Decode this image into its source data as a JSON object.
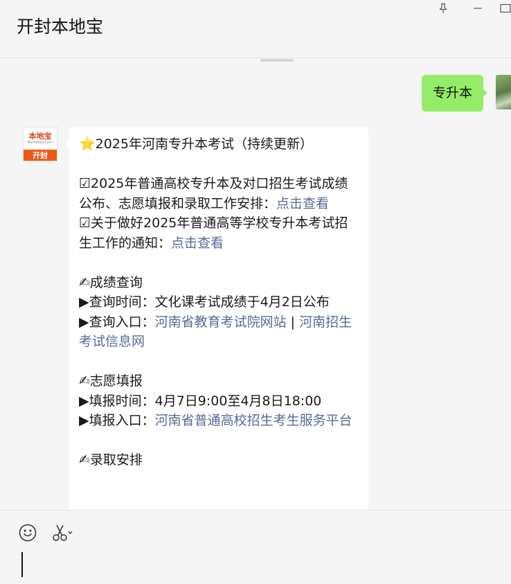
{
  "window": {
    "title": "开封本地宝"
  },
  "messages": {
    "outgoing": {
      "text": "专升本"
    },
    "incoming": {
      "avatar": {
        "logo_text": "本地宝",
        "logo_sub": "Bendibao.com",
        "city": "开封"
      },
      "lines": [
        {
          "segments": [
            {
              "text": "⭐2025年河南专升本考试（持续更新）"
            }
          ]
        },
        {
          "blank": true
        },
        {
          "segments": [
            {
              "text": "☑2025年普通高校专升本及对口招生考试成绩公布、志愿填报和录取工作安排："
            },
            {
              "text": "点击查看",
              "link": true
            }
          ]
        },
        {
          "segments": [
            {
              "text": "☑关于做好2025年普通高等学校专升本考试招生工作的通知："
            },
            {
              "text": "点击查看",
              "link": true
            }
          ]
        },
        {
          "blank": true
        },
        {
          "segments": [
            {
              "text": "✍成绩查询"
            }
          ]
        },
        {
          "segments": [
            {
              "text": "▶查询时间：文化课考试成绩于4月2日公布"
            }
          ]
        },
        {
          "segments": [
            {
              "text": "▶查询入口："
            },
            {
              "text": "河南省教育考试院网站",
              "link": true
            },
            {
              "text": " | "
            },
            {
              "text": "河南招生考试信息网",
              "link": true
            }
          ]
        },
        {
          "blank": true
        },
        {
          "segments": [
            {
              "text": "✍志愿填报"
            }
          ]
        },
        {
          "segments": [
            {
              "text": "▶填报时间：4月7日9:00至4月8日18:00"
            }
          ]
        },
        {
          "segments": [
            {
              "text": "▶填报入口："
            },
            {
              "text": "河南省普通高校招生考生服务平台",
              "link": true
            }
          ]
        },
        {
          "blank": true
        },
        {
          "segments": [
            {
              "text": "✍录取安排"
            }
          ]
        }
      ]
    }
  },
  "toolbar": {
    "icons": [
      "emoji-icon",
      "scissors-icon"
    ]
  },
  "input": {
    "value": ""
  },
  "colors": {
    "outgoing_bubble": "#95ec69",
    "link": "#576b95",
    "badge_orange": "#ea5a13"
  }
}
